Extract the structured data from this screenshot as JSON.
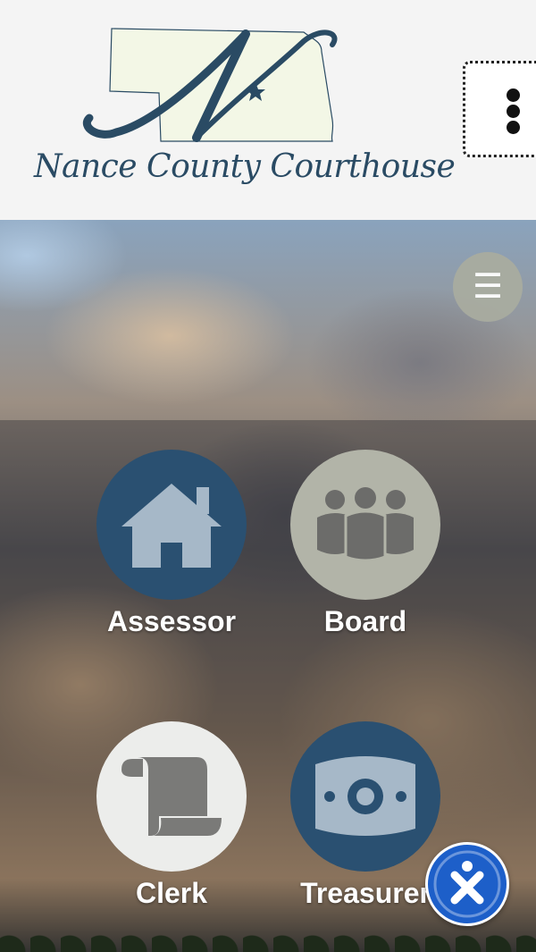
{
  "header": {
    "logo_letter": "N",
    "logo_text": "Nance County Courthouse",
    "kebab_icon": "more-vertical-icon"
  },
  "hero": {
    "menu_icon": "☰"
  },
  "tiles": [
    {
      "label": "Assessor",
      "icon": "house-icon",
      "color": "#2a5071"
    },
    {
      "label": "Board",
      "icon": "people-group-icon",
      "color": "#b2b4a8"
    },
    {
      "label": "Clerk",
      "icon": "scroll-icon",
      "color": "#ecedeb"
    },
    {
      "label": "Treasurer",
      "icon": "money-bill-icon",
      "color": "#2a5071"
    }
  ],
  "colors": {
    "brand_navy": "#2a4b64",
    "accessibility_blue": "#1d5fc9",
    "menu_gray": "#a9aca0"
  }
}
